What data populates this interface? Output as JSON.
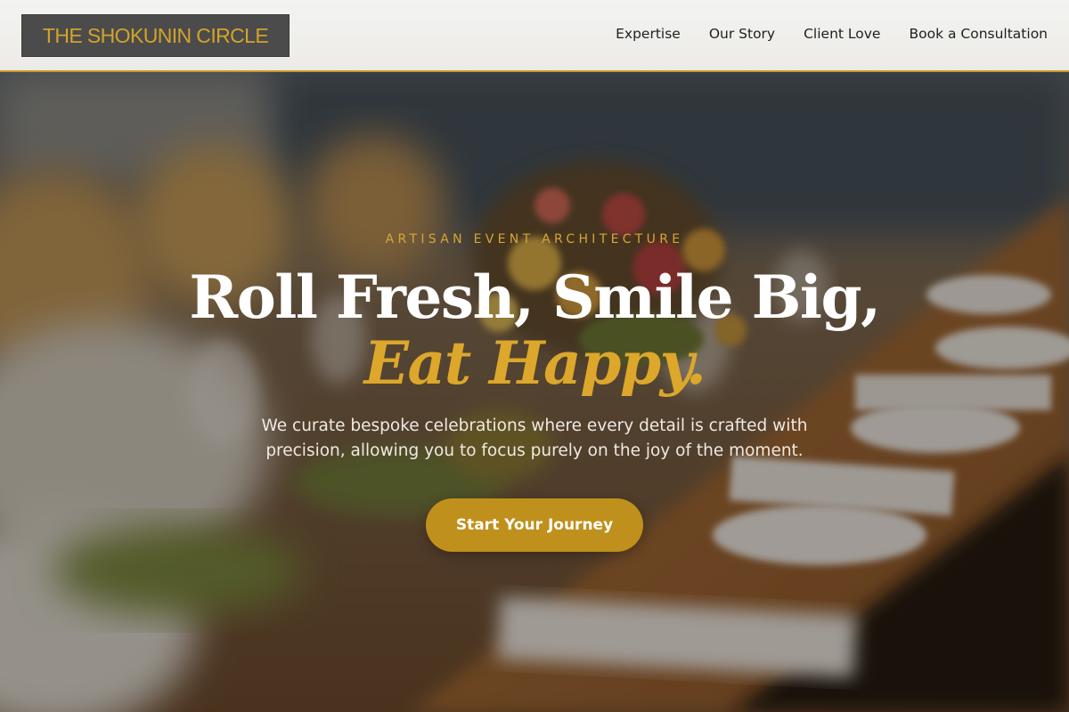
{
  "header": {
    "logo_text": "THE SHOKUNIN CIRCLE",
    "nav": [
      {
        "label": "Expertise"
      },
      {
        "label": "Our Story"
      },
      {
        "label": "Client Love"
      },
      {
        "label": "Book a Consultation"
      }
    ]
  },
  "hero": {
    "eyebrow": "ARTISAN EVENT ARCHITECTURE",
    "headline": "Roll Fresh, Smile Big,",
    "headline_accent": "Eat Happy.",
    "subtext": "We curate bespoke celebrations where every detail is crafted with precision, allowing you to focus purely on the joy of the moment.",
    "cta_label": "Start Your Journey",
    "background_description_icon": "banquet-table-photo"
  },
  "colors": {
    "accent_gold": "#c0901c",
    "headline_gold": "#dca72b",
    "logo_bg": "#4b4b4b",
    "header_bg": "#f1f1ef",
    "nav_text": "#1f1f1f"
  }
}
